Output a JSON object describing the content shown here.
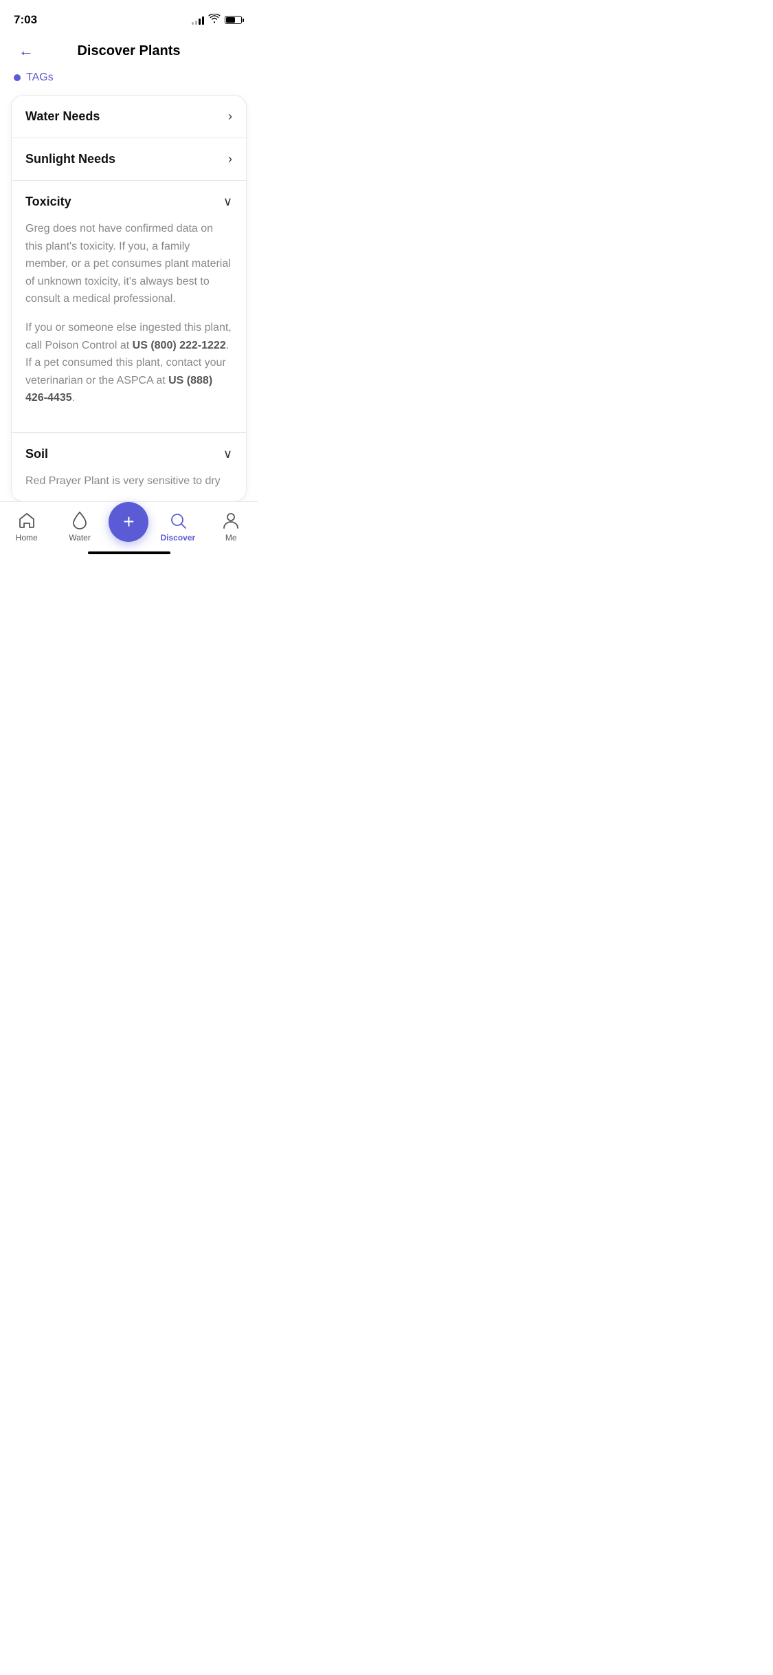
{
  "statusBar": {
    "time": "7:03"
  },
  "header": {
    "title": "Discover Plants",
    "backLabel": "←"
  },
  "tagsStrip": {
    "text": "TAGs"
  },
  "accordion": {
    "waterNeeds": {
      "label": "Water Needs",
      "icon": "›",
      "expanded": false
    },
    "sunlightNeeds": {
      "label": "Sunlight Needs",
      "icon": "›",
      "expanded": false
    },
    "toxicity": {
      "label": "Toxicity",
      "icon": "˅",
      "expanded": true,
      "paragraph1": "Greg does not have confirmed data on this plant's toxicity. If you, a family member, or a pet consumes plant material of unknown toxicity, it's always best to consult a medical professional.",
      "paragraph2_pre": "If you or someone else ingested this plant, call Poison Control at ",
      "paragraph2_bold1": "US (800) 222-1222",
      "paragraph2_mid": ". If a pet consumed this plant, contact your veterinarian or the ASPCA at ",
      "paragraph2_bold2": "US (888) 426-4435",
      "paragraph2_post": "."
    },
    "soil": {
      "label": "Soil",
      "icon": "˅",
      "expanded": true,
      "text": "Red Prayer Plant is very sensitive to dry"
    }
  },
  "bottomNav": {
    "home": {
      "label": "Home"
    },
    "water": {
      "label": "Water"
    },
    "add": {
      "icon": "+"
    },
    "discover": {
      "label": "Discover"
    },
    "me": {
      "label": "Me"
    }
  }
}
